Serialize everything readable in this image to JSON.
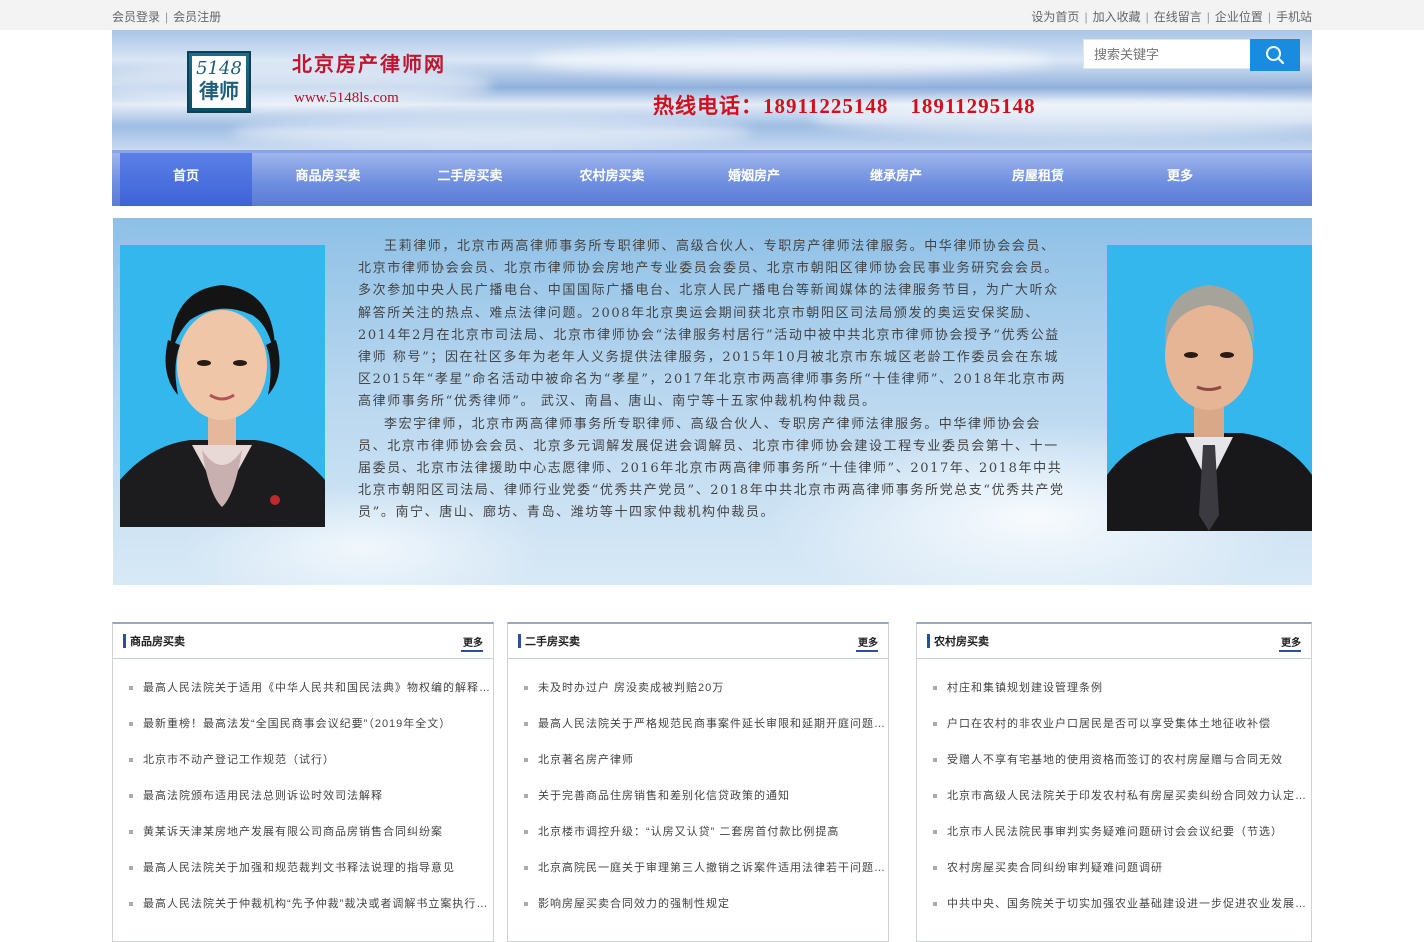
{
  "topbar": {
    "left": [
      {
        "label": "会员登录"
      },
      {
        "label": "会员注册"
      }
    ],
    "right": [
      {
        "label": "设为首页"
      },
      {
        "label": "加入收藏"
      },
      {
        "label": "在线留言"
      },
      {
        "label": "企业位置"
      },
      {
        "label": "手机站"
      }
    ]
  },
  "header": {
    "logo_number": "5148",
    "logo_text": "律师",
    "site_title": "北京房产律师网",
    "site_url": "www.5148ls.com",
    "hotline": "热线电话：18911225148　18911295148",
    "search_placeholder": "搜索关键字"
  },
  "nav": {
    "items": [
      {
        "label": "首页",
        "active": true
      },
      {
        "label": "商品房买卖"
      },
      {
        "label": "二手房买卖"
      },
      {
        "label": "农村房买卖"
      },
      {
        "label": "婚姻房产"
      },
      {
        "label": "继承房产"
      },
      {
        "label": "房屋租赁"
      },
      {
        "label": "更多"
      }
    ]
  },
  "intro": {
    "para1": "王莉律师，北京市两高律师事务所专职律师、高级合伙人、专职房产律师法律服务。中华律师协会会员、北京市律师协会会员、北京市律师协会房地产专业委员会委员、北京市朝阳区律师协会民事业务研究会会员。多次参加中央人民广播电台、中国国际广播电台、北京人民广播电台等新闻媒体的法律服务节目，为广大听众解答所关注的热点、难点法律问题。2008年北京奥运会期间获北京市朝阳区司法局颁发的奥运安保奖励、2014年2月在北京市司法局、北京市律师协会“法律服务村居行”活动中被中共北京市律师协会授予“优秀公益律师 称号”；因在社区多年为老年人义务提供法律服务，2015年10月被北京市东城区老龄工作委员会在东城区2015年“孝星”命名活动中被命名为“孝星”，2017年北京市两高律师事务所“十佳律师”、2018年北京市两高律师事务所“优秀律师”。 武汉、南昌、唐山、南宁等十五家仲裁机构仲裁员。",
    "para2": "李宏宇律师，北京市两高律师事务所专职律师、高级合伙人、专职房产律师法律服务。中华律师协会会员、北京市律师协会会员、北京多元调解发展促进会调解员、北京市律师协会建设工程专业委员会第十、十一届委员、北京市法律援助中心志愿律师、2016年北京市两高律师事务所“十佳律师”、2017年、2018年中共北京市朝阳区司法局、律师行业党委“优秀共产党员”、2018年中共北京市两高律师事务所党总支“优秀共产党员”。南宁、唐山、廊坊、青岛、潍坊等十四家仲裁机构仲裁员。"
  },
  "panels": [
    {
      "title": "商品房买卖",
      "more": "更多",
      "items": [
        "最高人民法院关于适用《中华人民共和国民法典》物权编的解释（一）",
        "最新重榜！最高法发“全国民商事会议纪要”（2019年全文）",
        "北京市不动产登记工作规范（试行）",
        "最高法院颁布适用民法总则诉讼时效司法解释",
        "黄某诉天津某房地产发展有限公司商品房销售合同纠纷案",
        "最高人民法院关于加强和规范裁判文书释法说理的指导意见",
        "最高人民法院关于仲裁机构“先予仲裁”裁决或者调解书立案执行的批复"
      ]
    },
    {
      "title": "二手房买卖",
      "more": "更多",
      "items": [
        "未及时办过户  房没卖成被判赔20万",
        "最高人民法院关于严格规范民商事案件延长审限和延期开庭问题的规定",
        "北京著名房产律师",
        "关于完善商品住房销售和差别化信贷政策的通知",
        "北京楼市调控升级：“认房又认贷” 二套房首付款比例提高",
        "北京高院民一庭关于审理第三人撤销之诉案件适用法律若干问题的解答",
        "影响房屋买卖合同效力的强制性规定"
      ]
    },
    {
      "title": "农村房买卖",
      "more": "更多",
      "items": [
        "村庄和集镇规划建设管理条例",
        "户口在农村的非农业户口居民是否可以享受集体土地征收补偿",
        "受赠人不享有宅基地的使用资格而签订的农村房屋赠与合同无效",
        "北京市高级人民法院关于印发农村私有房屋买卖纠纷合同效力认定及处理原则研讨会会议纪要的通知",
        "北京市人民法院民事审判实务疑难问题研讨会会议纪要（节选）",
        "农村房屋买卖合同纠纷审判疑难问题调研",
        "中共中央、国务院关于切实加强农业基础建设进一步促进农业发展农民增收的若干意见"
      ]
    }
  ]
}
